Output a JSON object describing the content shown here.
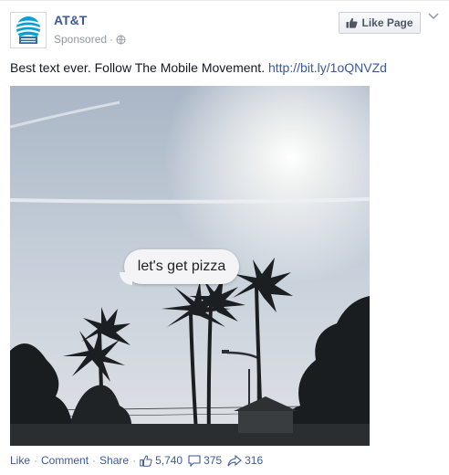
{
  "post": {
    "page_name": "AT&T",
    "sponsored_label": "Sponsored",
    "like_page_label": "Like Page",
    "body_text": "Best text ever. Follow The Mobile Movement.",
    "link_text": "http://bit.ly/1oQNVZd",
    "photo_caption_bubble": "let's get pizza"
  },
  "actions": {
    "like": "Like",
    "comment": "Comment",
    "share": "Share",
    "like_count": "5,740",
    "comment_count": "375",
    "share_count": "316"
  },
  "colors": {
    "link": "#3b5998",
    "meta_gray": "#9197a3",
    "brand_blue": "#0a9ed9"
  },
  "icons": [
    "globe-icon",
    "thumbs-up-icon",
    "chevron-down-icon",
    "comment-icon",
    "share-icon",
    "att-globe-logo"
  ]
}
